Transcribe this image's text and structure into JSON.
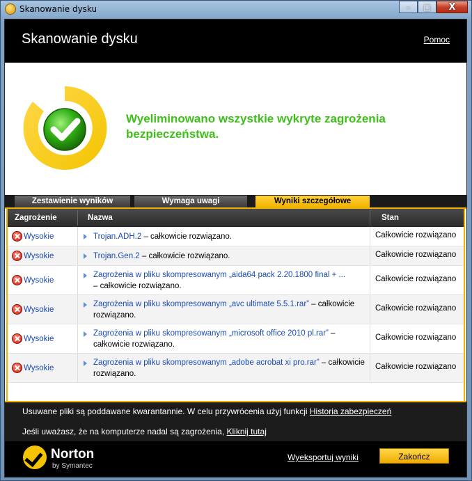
{
  "window": {
    "title": "Skanowanie dysku",
    "minimize": "–",
    "maximize": "□",
    "close": "X"
  },
  "header": {
    "title": "Skanowanie dysku",
    "help_label": "Pomoc"
  },
  "status": {
    "message": "Wyeliminowano wszystkie wykryte zagrożenia bezpieczeństwa.",
    "icon": "green-check-icon"
  },
  "tabs": [
    {
      "label": "Zestawienie wyników"
    },
    {
      "label": "Wymaga uwagi"
    },
    {
      "label": "Wyniki szczegółowe",
      "active": true
    }
  ],
  "table": {
    "headers": {
      "threat": "Zagrożenie",
      "name": "Nazwa",
      "state": "Stan"
    },
    "rows": [
      {
        "severity": "Wysokie",
        "name_link": "Trojan.ADH.2",
        "name_rest": " – całkowicie rozwiązano.",
        "state": "Całkowicie rozwiązano"
      },
      {
        "severity": "Wysokie",
        "name_link": "Trojan.Gen.2",
        "name_rest": " – całkowicie rozwiązano.",
        "state": "Całkowicie rozwiązano"
      },
      {
        "severity": "Wysokie",
        "name_link": "Zagrożenia w pliku skompresowanym „aida64 pack 2.20.1800 final + ...",
        "name_rest": " – całkowicie rozwiązano.",
        "state": "Całkowicie rozwiązano"
      },
      {
        "severity": "Wysokie",
        "name_link": "Zagrożenia w pliku skompresowanym „avc ultimate 5.5.1.rar”",
        "name_rest": " – całkowicie rozwiązano.",
        "state": "Całkowicie rozwiązano"
      },
      {
        "severity": "Wysokie",
        "name_link": "Zagrożenia w pliku skompresowanym „microsoft office 2010 pl.rar”",
        "name_rest": " – całkowicie rozwiązano.",
        "state": "Całkowicie rozwiązano"
      },
      {
        "severity": "Wysokie",
        "name_link": "Zagrożenia w pliku skompresowanym „adobe acrobat xi pro.rar”",
        "name_rest": " – całkowicie rozwiązano.",
        "state": "Całkowicie rozwiązano"
      }
    ]
  },
  "footer": {
    "quarantine_text": "Usuwane pliki są poddawane kwarantannie. W celu przywrócenia użyj funkcji ",
    "quarantine_link": "Historia zabezpieczeń",
    "threats_text": "Jeśli uważasz, że na komputerze nadal są zagrożenia, ",
    "threats_link": "Kliknij tutaj"
  },
  "bottom": {
    "brand": "Norton",
    "brand_sub": "by Symantec",
    "export_label": "Wyeksportuj wyniki",
    "finish_label": "Zakończ"
  },
  "colors": {
    "accent": "#f0b400",
    "success": "#3fbf19",
    "link": "#1a4bb5"
  }
}
